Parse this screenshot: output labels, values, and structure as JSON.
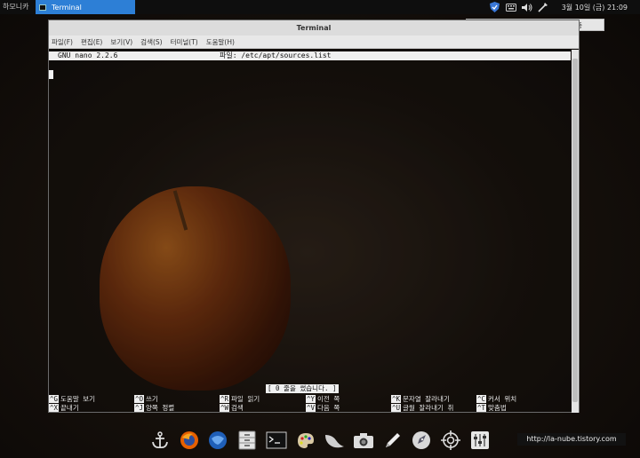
{
  "top_panel": {
    "menu_label": "하모니카",
    "task_label": "Terminal",
    "clock": "3월 10일 (금) 21:09",
    "tooltip": "이더넷 네트워크 연결 '유선 연결 1' 사용 중",
    "tray_icons": [
      "shield-icon",
      "keyboard-icon",
      "volume-icon",
      "network-icon"
    ]
  },
  "terminal": {
    "title": "Terminal",
    "menus": [
      "파일(F)",
      "편집(E)",
      "보기(V)",
      "검색(S)",
      "터미널(T)",
      "도움말(H)"
    ],
    "nano_version": "GNU nano 2.2.6",
    "file_label": "파일: /etc/apt/sources.list",
    "status_message": "[ 0 줄을 썼습니다. ]",
    "shortcuts": [
      {
        "key": "^G",
        "label": "도움말 보기"
      },
      {
        "key": "^O",
        "label": "쓰기"
      },
      {
        "key": "^R",
        "label": "파일 읽기"
      },
      {
        "key": "^Y",
        "label": "이전 쪽"
      },
      {
        "key": "^K",
        "label": "문자열 잘라내기"
      },
      {
        "key": "^C",
        "label": "커서 위치"
      },
      {
        "key": "^X",
        "label": "끝내기"
      },
      {
        "key": "^J",
        "label": "양쪽 정렬"
      },
      {
        "key": "^W",
        "label": "검색"
      },
      {
        "key": "^V",
        "label": "다음 쪽"
      },
      {
        "key": "^U",
        "label": "글월 잘라내기 취"
      },
      {
        "key": "^T",
        "label": "맞춤법"
      }
    ]
  },
  "dock": {
    "items": [
      "anchor-icon",
      "firefox-icon",
      "thunderbird-icon",
      "file-cabinet-icon",
      "terminal-icon",
      "paint-palette-icon",
      "bird-icon",
      "camera-icon",
      "pen-icon",
      "rocket-icon",
      "target-icon",
      "mixer-icon"
    ]
  },
  "watermark_url": "http://la-nube.tistory.com"
}
